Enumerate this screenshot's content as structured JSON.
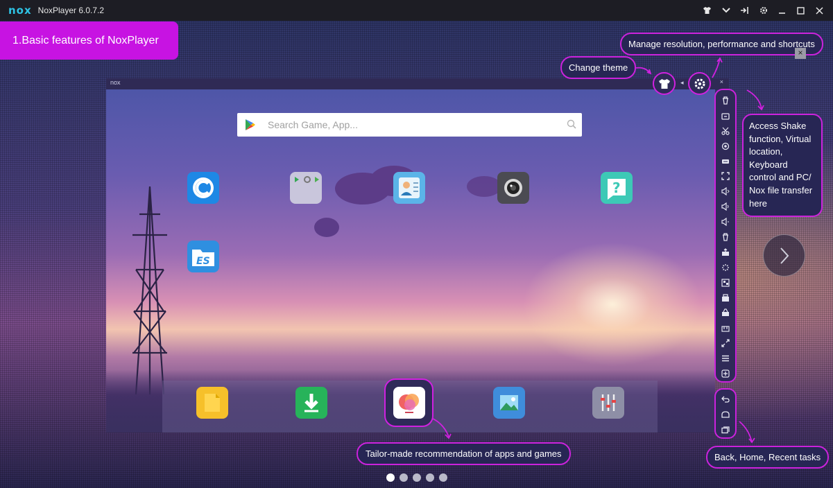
{
  "window": {
    "logo": "nox",
    "title": "NoxPlayer 6.0.7.2"
  },
  "feature_tag": "1.Basic features of NoxPlayer",
  "emulator": {
    "header_logo": "nox",
    "search": {
      "placeholder": "Search Game, App..."
    }
  },
  "callouts": {
    "change_theme": "Change theme",
    "manage": "Manage resolution, performance and shortcuts",
    "shake_lines": [
      "Access Shake",
      "function, Virtual",
      "location,",
      "Keyboard",
      "control and PC/",
      "Nox file transfer",
      "here"
    ],
    "recommendation": "Tailor-made recommendation of apps and games",
    "nav": "Back, Home, Recent tasks"
  },
  "icons": {
    "title_controls": [
      "shirt-icon",
      "chevron-down-icon",
      "pin-icon",
      "gear-icon",
      "minimize-icon",
      "maximize-icon",
      "close-icon"
    ],
    "home_apps": [
      "cleaner-app-icon",
      "google-apps-folder-icon",
      "contacts-app-icon",
      "camera-app-icon",
      "help-app-icon",
      "es-file-explorer-icon"
    ],
    "dock_apps": [
      "file-manager-icon",
      "download-app-icon",
      "app-center-icon",
      "gallery-app-icon",
      "settings-app-icon"
    ],
    "side_toolbar": [
      "trash-icon",
      "screenshot-icon",
      "scissors-icon",
      "location-icon",
      "keyboard-icon",
      "fullscreen-icon",
      "volume-up-icon",
      "volume-icon",
      "volume-down-icon",
      "clear-icon",
      "apk-install-icon",
      "loading-icon",
      "multi-instance-icon",
      "record-icon",
      "macro-icon",
      "shared-folder-icon",
      "resize-icon",
      "menu-icon",
      "add-icon"
    ],
    "nav_toolbar": [
      "back-icon",
      "home-icon",
      "recent-tasks-icon"
    ]
  },
  "pager": {
    "count": 5,
    "active_index": 0
  },
  "colors": {
    "accent": "#cc22dd",
    "feature_tag": "#c713e2",
    "titlebar": "#1d1d24"
  }
}
